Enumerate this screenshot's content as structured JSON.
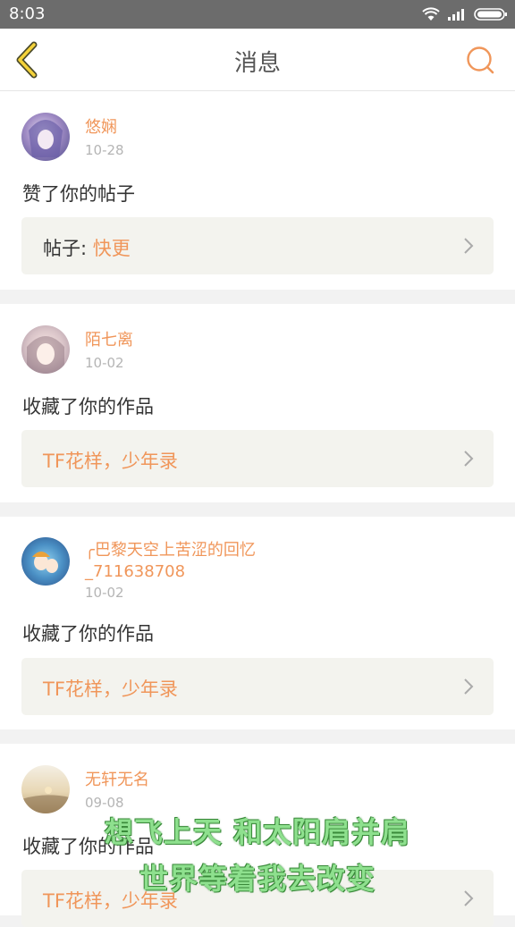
{
  "status": {
    "time": "8:03"
  },
  "header": {
    "title": "消息"
  },
  "messages": [
    {
      "user": "悠娴",
      "date": "10-28",
      "action": "赞了你的帖子",
      "ref_prefix": "帖子: ",
      "ref_value": "快更"
    },
    {
      "user": "陌七离",
      "date": "10-02",
      "action": "收藏了你的作品",
      "ref_prefix": "",
      "ref_value": "TF花样，少年录"
    },
    {
      "user": "╭巴黎天空上苦涩的回忆_711638708",
      "date": "10-02",
      "action": "收藏了你的作品",
      "ref_prefix": "",
      "ref_value": "TF花样，少年录"
    },
    {
      "user": "无轩无名",
      "date": "09-08",
      "action": "收藏了你的作品",
      "ref_prefix": "",
      "ref_value": "TF花样，少年录"
    }
  ],
  "overlay": {
    "line1": "想飞上天 和太阳肩并肩",
    "line2": "世界等着我去改变"
  },
  "colors": {
    "accent": "#f0965a",
    "status_bar": "#6c6c6c",
    "ref_bg": "#f3f3ee"
  },
  "icons": [
    "wifi-icon",
    "signal-icon",
    "battery-icon",
    "back-chevron-icon",
    "search-icon",
    "chevron-right-icon"
  ]
}
